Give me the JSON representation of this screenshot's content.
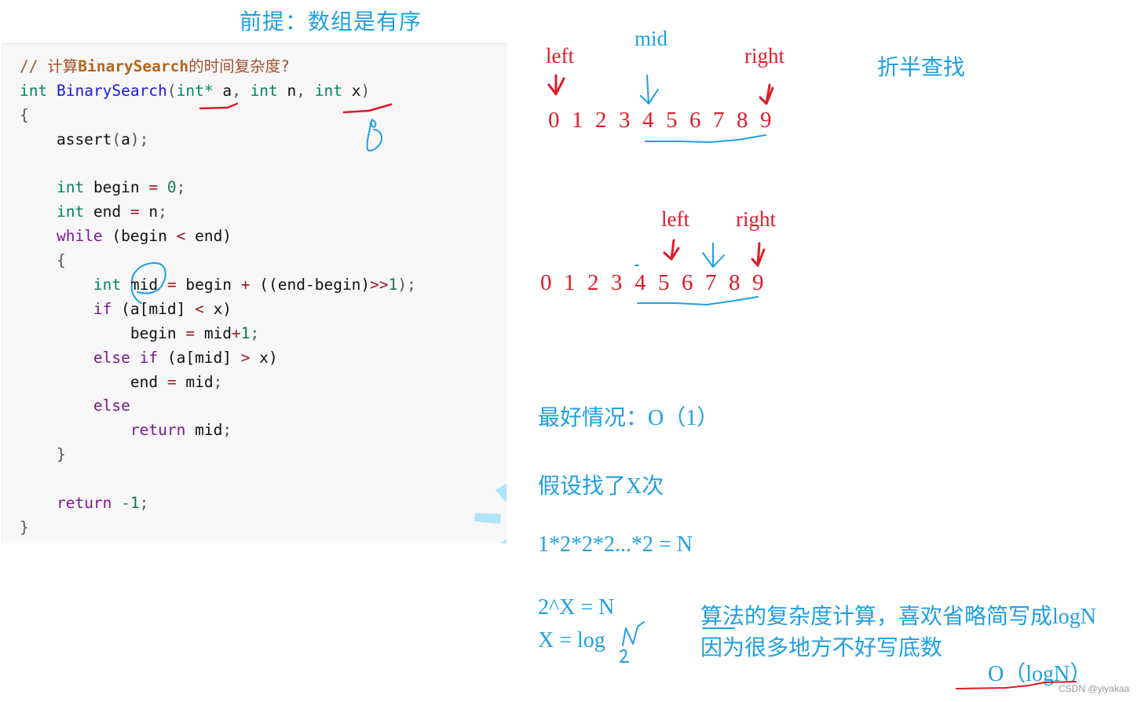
{
  "header": {
    "premise": "前提：数组是有序"
  },
  "code": {
    "lines": [
      [
        {
          "t": "// 计算",
          "c": "cmt"
        },
        {
          "t": "BinarySearch",
          "c": "cmt-b"
        },
        {
          "t": "的时间复杂度?",
          "c": "cmt"
        }
      ],
      [
        {
          "t": "int",
          "c": "kw-type"
        },
        {
          "t": " "
        },
        {
          "t": "BinarySearch",
          "c": "fn"
        },
        {
          "t": "(",
          "c": "punct"
        },
        {
          "t": "int*",
          "c": "kw-type"
        },
        {
          "t": " a"
        },
        {
          "t": ", ",
          "c": "punct"
        },
        {
          "t": "int",
          "c": "kw-type"
        },
        {
          "t": " n"
        },
        {
          "t": ", ",
          "c": "punct"
        },
        {
          "t": "int",
          "c": "kw-type"
        },
        {
          "t": " x"
        },
        {
          "t": ")",
          "c": "punct"
        }
      ],
      [
        {
          "t": "{",
          "c": "punct"
        }
      ],
      [
        {
          "t": "    assert"
        },
        {
          "t": "(",
          "c": "punct"
        },
        {
          "t": "a"
        },
        {
          "t": ");",
          "c": "punct"
        }
      ],
      [
        {
          "t": ""
        }
      ],
      [
        {
          "t": "    "
        },
        {
          "t": "int",
          "c": "kw-type"
        },
        {
          "t": " begin "
        },
        {
          "t": "=",
          "c": "op"
        },
        {
          "t": " "
        },
        {
          "t": "0",
          "c": "num"
        },
        {
          "t": ";",
          "c": "punct"
        }
      ],
      [
        {
          "t": "    "
        },
        {
          "t": "int",
          "c": "kw-type"
        },
        {
          "t": " end "
        },
        {
          "t": "=",
          "c": "op"
        },
        {
          "t": " n"
        },
        {
          "t": ";",
          "c": "punct"
        }
      ],
      [
        {
          "t": "    "
        },
        {
          "t": "while",
          "c": "kw-ctrl"
        },
        {
          "t": " (begin "
        },
        {
          "t": "<",
          "c": "op"
        },
        {
          "t": " end)"
        }
      ],
      [
        {
          "t": "    "
        },
        {
          "t": "{",
          "c": "punct"
        }
      ],
      [
        {
          "t": "        "
        },
        {
          "t": "int",
          "c": "kw-type"
        },
        {
          "t": " mid "
        },
        {
          "t": "=",
          "c": "op"
        },
        {
          "t": " begin "
        },
        {
          "t": "+",
          "c": "op"
        },
        {
          "t": " ((end-begin)"
        },
        {
          "t": ">>",
          "c": "op"
        },
        {
          "t": "1",
          "c": "num"
        },
        {
          "t": ");",
          "c": "punct"
        }
      ],
      [
        {
          "t": "        "
        },
        {
          "t": "if",
          "c": "kw-ctrl"
        },
        {
          "t": " (a[mid] "
        },
        {
          "t": "<",
          "c": "op"
        },
        {
          "t": " x)"
        }
      ],
      [
        {
          "t": "            begin "
        },
        {
          "t": "=",
          "c": "op"
        },
        {
          "t": " mid"
        },
        {
          "t": "+",
          "c": "op"
        },
        {
          "t": "1",
          "c": "num"
        },
        {
          "t": ";",
          "c": "punct"
        }
      ],
      [
        {
          "t": "        "
        },
        {
          "t": "else if",
          "c": "kw-ctrl"
        },
        {
          "t": " (a[mid] "
        },
        {
          "t": ">",
          "c": "op"
        },
        {
          "t": " x)"
        }
      ],
      [
        {
          "t": "            end "
        },
        {
          "t": "=",
          "c": "op"
        },
        {
          "t": " mid"
        },
        {
          "t": ";",
          "c": "punct"
        }
      ],
      [
        {
          "t": "        "
        },
        {
          "t": "else",
          "c": "kw-ctrl"
        }
      ],
      [
        {
          "t": "            "
        },
        {
          "t": "return",
          "c": "kw-ctrl"
        },
        {
          "t": " mid"
        },
        {
          "t": ";",
          "c": "punct"
        }
      ],
      [
        {
          "t": "    "
        },
        {
          "t": "}",
          "c": "punct"
        }
      ],
      [
        {
          "t": ""
        }
      ],
      [
        {
          "t": "    "
        },
        {
          "t": "return",
          "c": "kw-ctrl"
        },
        {
          "t": " "
        },
        {
          "t": "-1",
          "c": "num"
        },
        {
          "t": ";",
          "c": "punct"
        }
      ],
      [
        {
          "t": "}",
          "c": "punct"
        }
      ]
    ]
  },
  "diagram1": {
    "left_label": "left",
    "mid_label": "mid",
    "right_label": "right",
    "digits": [
      "0",
      "1",
      "2",
      "3",
      "4",
      "5",
      "6",
      "7",
      "8",
      "9"
    ],
    "title": "折半查找"
  },
  "diagram2": {
    "left_label": "left",
    "right_label": "right",
    "digits": [
      "0",
      "1",
      "2",
      "3",
      "4",
      "5",
      "6",
      "7",
      "8",
      "9"
    ]
  },
  "notes": {
    "best_case": "最好情况：O（1）",
    "assume": "假设找了X次",
    "product": "1*2*2*2...*2 = N",
    "power": "2^X = N",
    "log": "X = log",
    "log_hand_n": "N",
    "log_hand_base": "2",
    "explain_line1": "算法的复杂度计算，喜欢省略简写成logN",
    "explain_line2": "因为很多地方不好写底数",
    "result": "O（logN）"
  },
  "annotation_colors": {
    "red": "#e01a28",
    "blue": "#1ea0e0"
  },
  "watermark": "CSDN @yiyakaa"
}
